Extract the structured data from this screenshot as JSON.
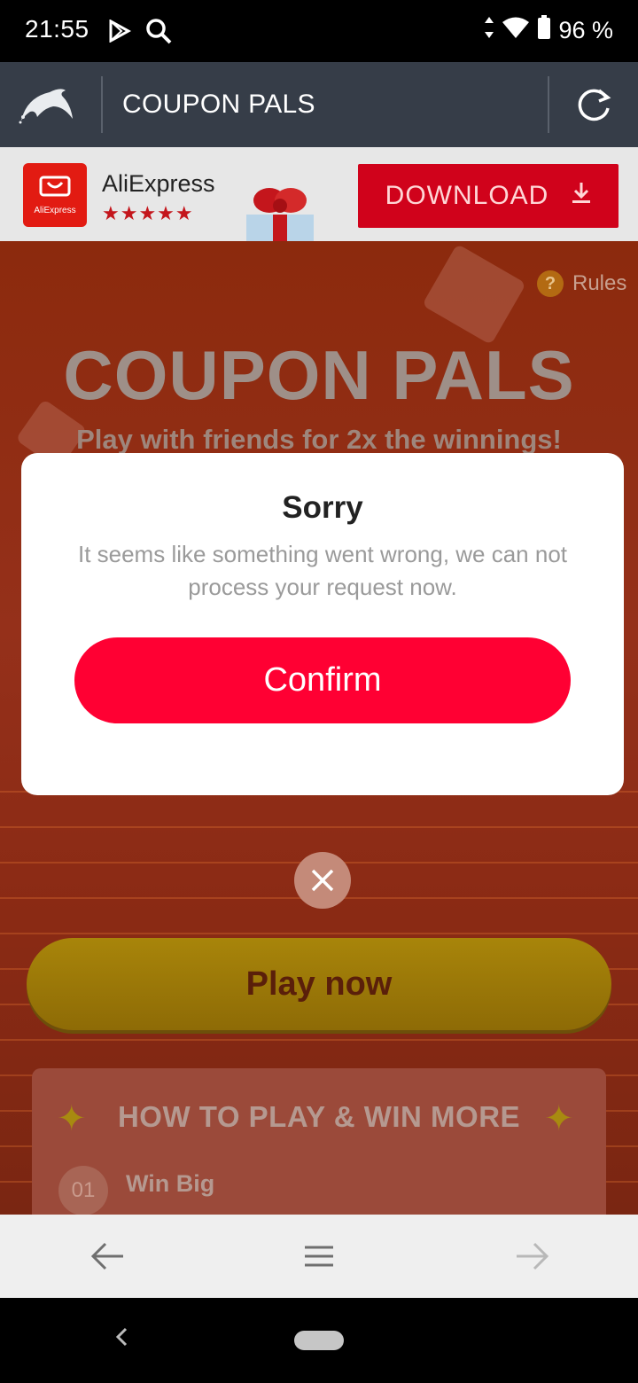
{
  "status_bar": {
    "time": "21:55",
    "battery": "96 %"
  },
  "browser": {
    "title": "COUPON PALS"
  },
  "ad": {
    "app_name": "AliExpress",
    "logo_text": "AliExpress",
    "rating_stars": "★★★★★",
    "download_label": "DOWNLOAD"
  },
  "page": {
    "rules_label": "Rules",
    "hero_title": "COUPON PALS",
    "hero_subtitle": "Play with friends for 2x the winnings!",
    "play_label": "Play now",
    "howto_title": "HOW TO PLAY & WIN MORE",
    "step_number": "01",
    "step_title": "Win Big"
  },
  "dialog": {
    "title": "Sorry",
    "message": "It seems like something went wrong, we can not process your request now.",
    "confirm_label": "Confirm"
  }
}
